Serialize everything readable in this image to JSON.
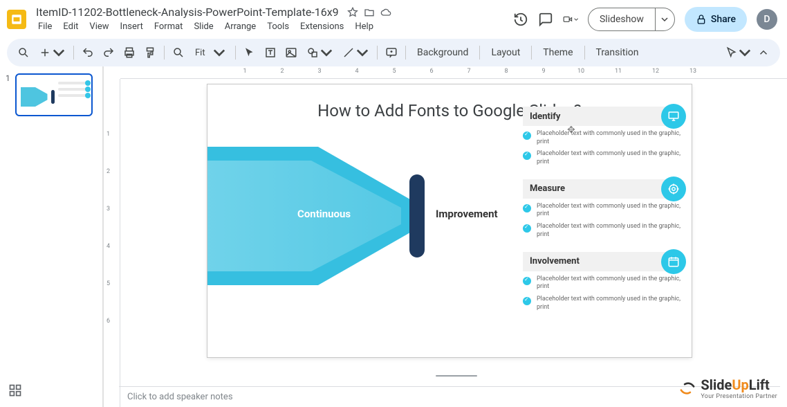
{
  "colors": {
    "accent": "#2dc8e8",
    "dark": "#1f3a5f",
    "share_bg": "#c2e7ff",
    "select": "#0b57d0"
  },
  "doc": {
    "title": "ItemID-11202-Bottleneck-Analysis-PowerPoint-Template-16x9",
    "avatar_initial": "D"
  },
  "menu": [
    "File",
    "Edit",
    "View",
    "Insert",
    "Format",
    "Slide",
    "Arrange",
    "Tools",
    "Extensions",
    "Help"
  ],
  "title_actions": {
    "slideshow": "Slideshow",
    "share": "Share"
  },
  "toolbar": {
    "zoom": "Fit",
    "panels": [
      "Background",
      "Layout",
      "Theme",
      "Transition"
    ]
  },
  "ruler_h": [
    "",
    "1",
    "2",
    "3",
    "4",
    "5",
    "6",
    "7",
    "8",
    "9",
    "10",
    "11",
    "12",
    "13"
  ],
  "ruler_v": [
    "",
    "1",
    "2",
    "3",
    "4",
    "5",
    "6"
  ],
  "filmstrip": {
    "slide1_number": "1"
  },
  "slide": {
    "title": "How to Add Fonts to Google Slides?",
    "label_left": "Continuous",
    "label_right": "Improvement",
    "sections": [
      {
        "heading": "Identify",
        "icon": "monitor",
        "bullets": [
          "Placeholder text with commonly used in the graphic, print",
          "Placeholder text with commonly used in the graphic, print"
        ]
      },
      {
        "heading": "Measure",
        "icon": "target",
        "bullets": [
          "Placeholder text with commonly used in the graphic, print",
          "Placeholder text with commonly used in the graphic, print"
        ]
      },
      {
        "heading": "Involvement",
        "icon": "calendar",
        "bullets": [
          "Placeholder text with commonly used in the graphic, print",
          "Placeholder text with commonly used in the graphic, print"
        ]
      }
    ]
  },
  "notes_placeholder": "Click to add speaker notes",
  "watermark": {
    "brand1": "Slide",
    "brand2": "Up",
    "brand3": "Lift",
    "tagline": "Your Presentation Partner"
  }
}
